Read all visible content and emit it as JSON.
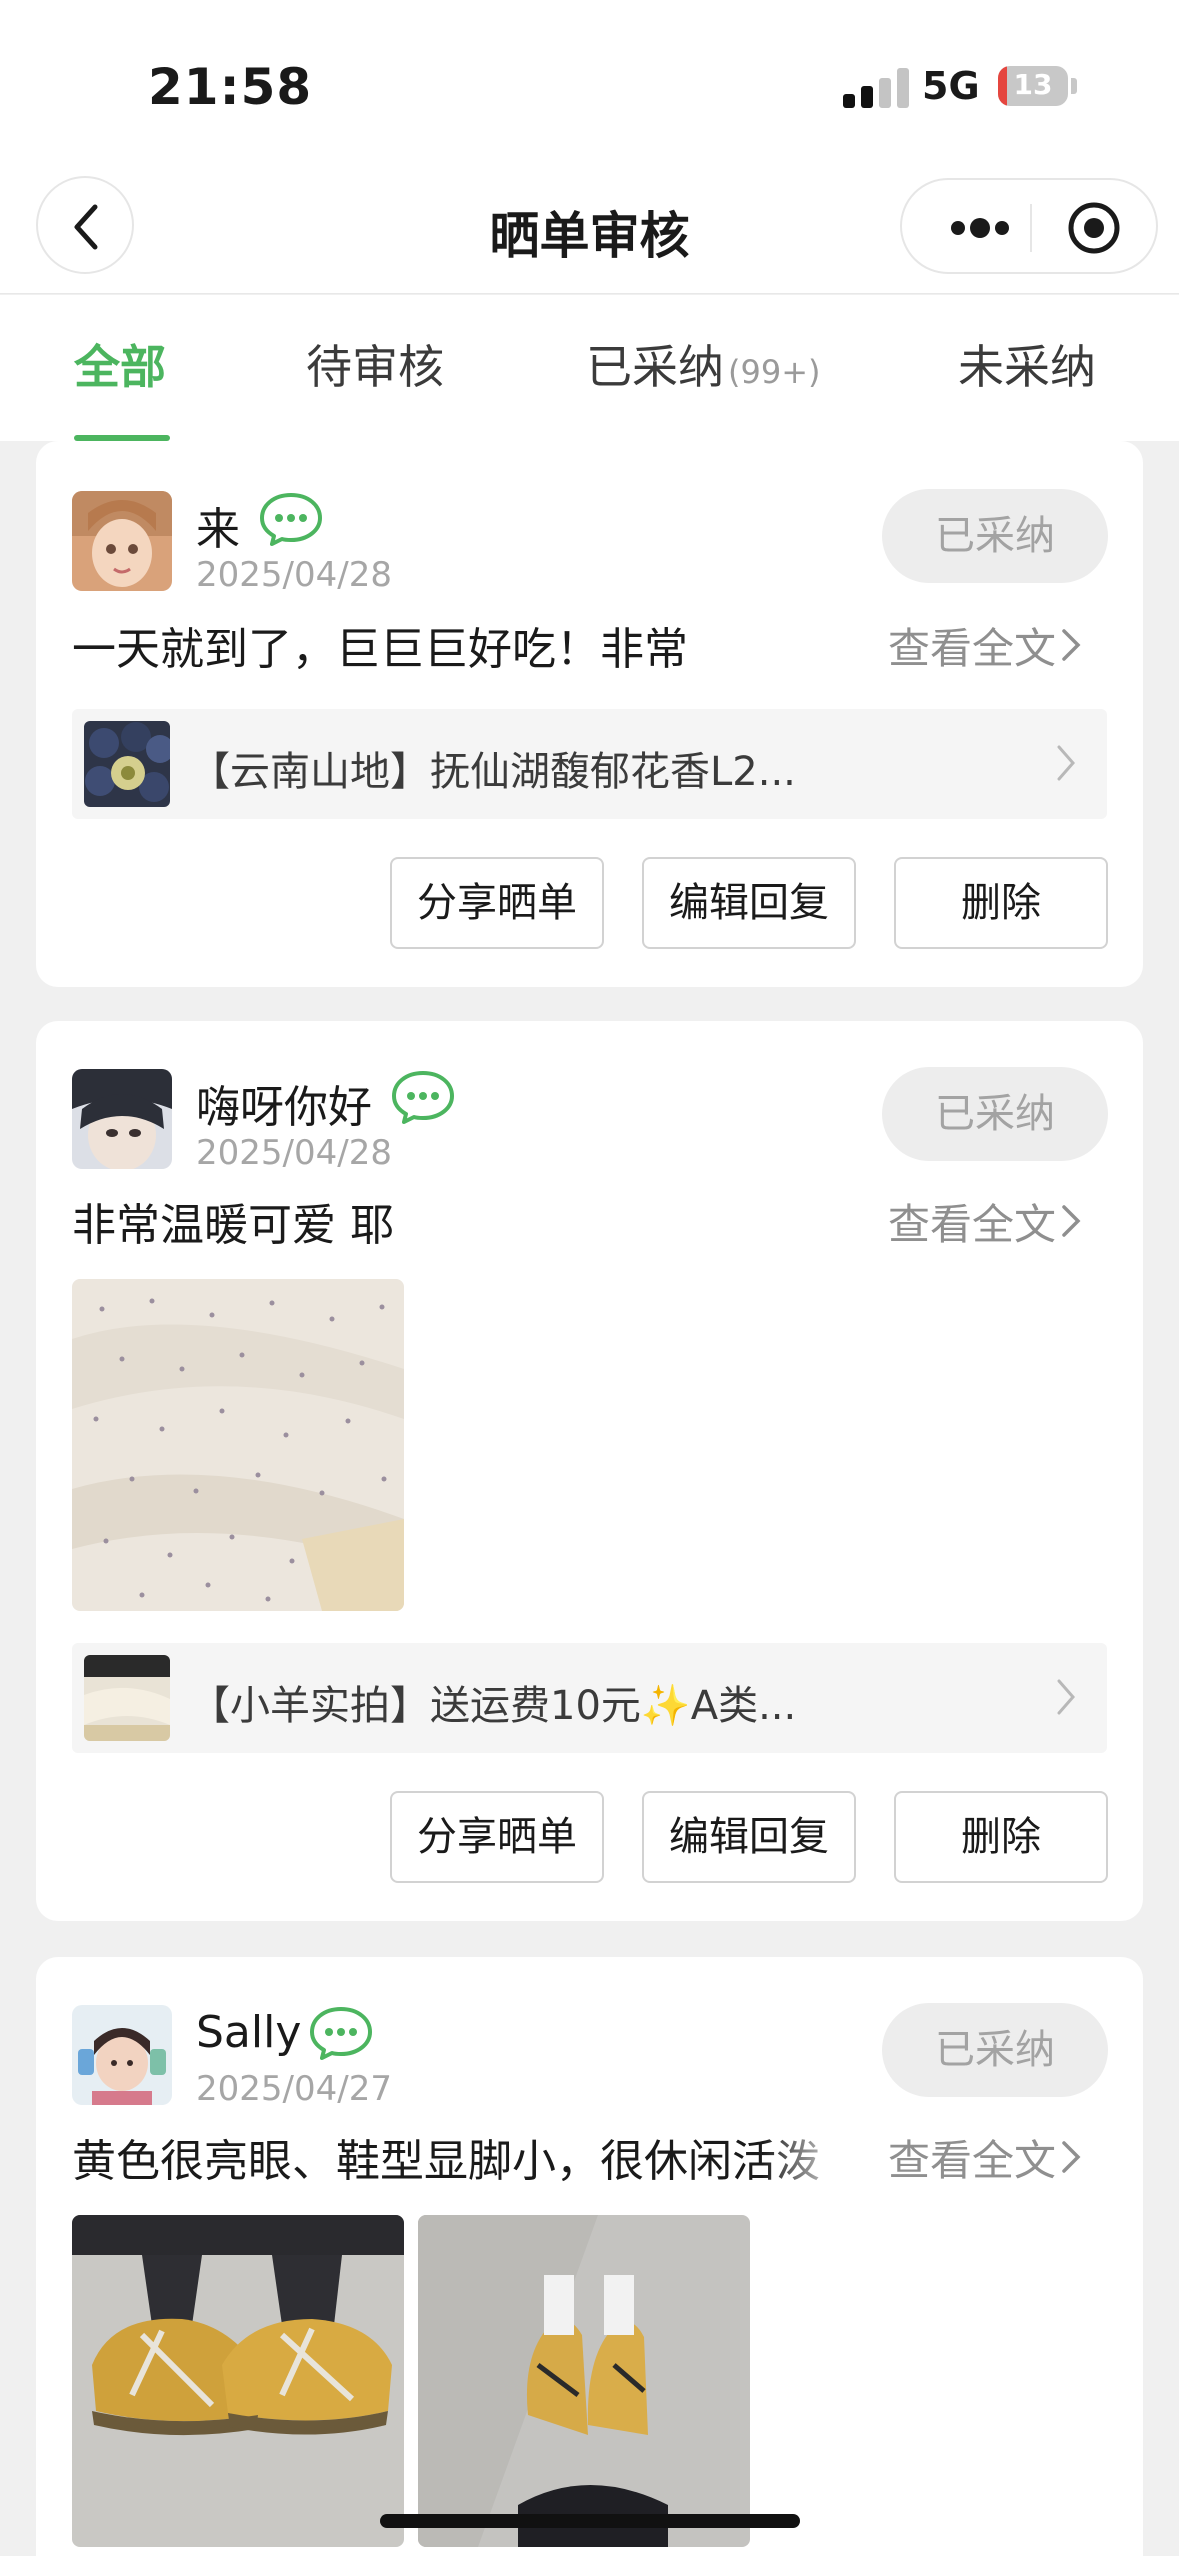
{
  "status_bar": {
    "time": "21:58",
    "network": "5G",
    "battery": "13",
    "battery_level": 0.13
  },
  "nav": {
    "title": "晒单审核"
  },
  "tabs": [
    {
      "label": "全部",
      "count": ""
    },
    {
      "label": "待审核",
      "count": ""
    },
    {
      "label": "已采纳",
      "count": "(99+)"
    },
    {
      "label": "未采纳",
      "count": ""
    }
  ],
  "labels": {
    "view_full": "查看全文",
    "share": "分享晒单",
    "edit_reply": "编辑回复",
    "delete": "删除"
  },
  "reviews": [
    {
      "username": "来",
      "date": "2025/04/28",
      "status": "已采纳",
      "content": "一天就到了，巨巨巨好吃！非常",
      "product_title": "【云南山地】抚仙湖馥郁花香L2..."
    },
    {
      "username": "嗨呀你好",
      "date": "2025/04/28",
      "status": "已采纳",
      "content": "非常温暖可爱 耶",
      "product_title": "【小羊实拍】送运费10元✨A类..."
    },
    {
      "username": "Sally",
      "date": "2025/04/27",
      "status": "已采纳",
      "content": "黄色很亮眼、鞋型显脚小，很休闲活泼"
    }
  ],
  "colors": {
    "accent": "#4cb55f",
    "pill_bg": "#ededed",
    "page_bg": "#f0f0f0"
  },
  "icons": [
    "back-arrow-icon",
    "more-dots-icon",
    "target-icon",
    "wechat-chat-icon",
    "chevron-right-icon"
  ]
}
